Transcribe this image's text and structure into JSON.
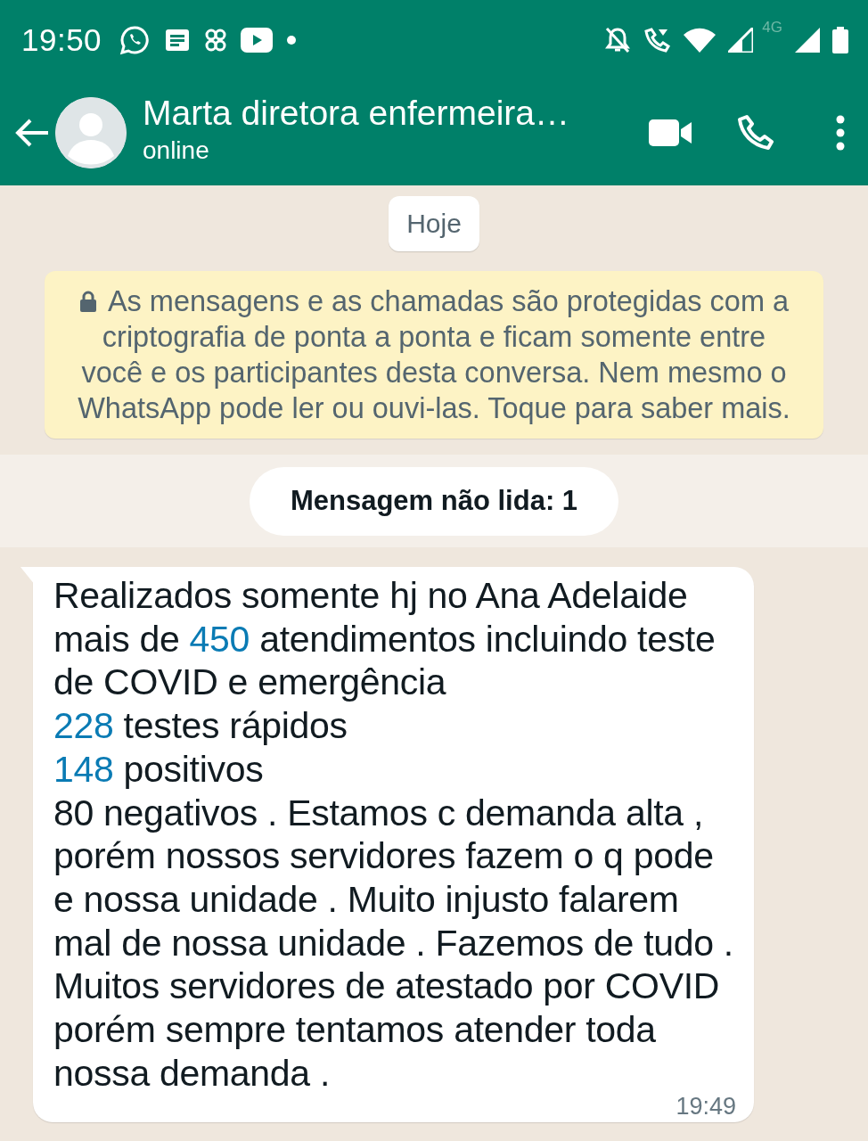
{
  "status_bar": {
    "time": "19:50",
    "network_label": "4G"
  },
  "header": {
    "contact_name": "Marta diretora enfermeira…",
    "status": "online"
  },
  "date_chip": "Hoje",
  "encryption_notice": "As mensagens e as chamadas são protegidas com a criptografia de ponta a ponta e ficam somente entre você e os participantes desta conversa. Nem mesmo o WhatsApp pode ler ou ouvi-las. Toque para saber mais.",
  "unread_banner": "Mensagem não lida: 1",
  "messages": [
    {
      "time": "19:49",
      "segments": [
        {
          "kind": "text",
          "text": "Realizados somente hj no Ana Adelaide mais de "
        },
        {
          "kind": "link",
          "text": "450"
        },
        {
          "kind": "text",
          "text": " atendimentos incluindo teste de COVID e emergência\n"
        },
        {
          "kind": "link",
          "text": "228"
        },
        {
          "kind": "text",
          "text": " testes rápidos\n"
        },
        {
          "kind": "link",
          "text": "148"
        },
        {
          "kind": "text",
          "text": " positivos\n80 negativos . Estamos c demanda alta , porém nossos servidores fazem o q pode e nossa unidade . Muito injusto falarem mal de nossa unidade . Fazemos de tudo . Muitos servidores de atestado por COVID porém sempre tentamos atender toda nossa demanda ."
        }
      ]
    }
  ]
}
